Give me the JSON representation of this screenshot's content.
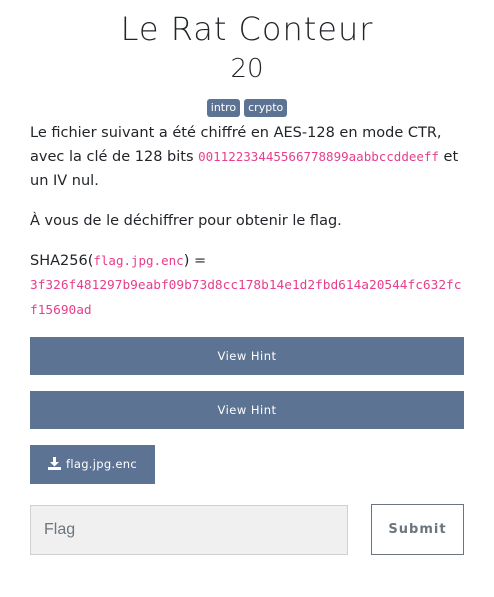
{
  "challenge": {
    "title": "Le Rat Conteur",
    "points": "20",
    "tags": [
      "intro",
      "crypto"
    ]
  },
  "description": {
    "p1_before_key": "Le fichier suivant a été chiffré en AES-128 en mode CTR, avec la clé de 128 bits ",
    "key": "00112233445566778899aabbccddeeff",
    "p1_after_key": " et un IV nul.",
    "p2": "À vous de le déchiffrer pour obtenir le flag.",
    "sha_prefix": "SHA256(",
    "sha_file": "flag.jpg.enc",
    "sha_suffix": ") =",
    "sha_value": "3f326f481297b9eabf09b73d8cc178b14e1d2fbd614a20544fc632fcf15690ad"
  },
  "hints": [
    {
      "label": "View Hint"
    },
    {
      "label": "View Hint"
    }
  ],
  "file": {
    "name": "flag.jpg.enc",
    "icon": "download-icon"
  },
  "form": {
    "flag_placeholder": "Flag",
    "flag_value": "",
    "submit_label": "Submit"
  },
  "colors": {
    "accent": "#5c7393",
    "code": "#e83e8c",
    "input_bg": "#f0f0f0"
  }
}
